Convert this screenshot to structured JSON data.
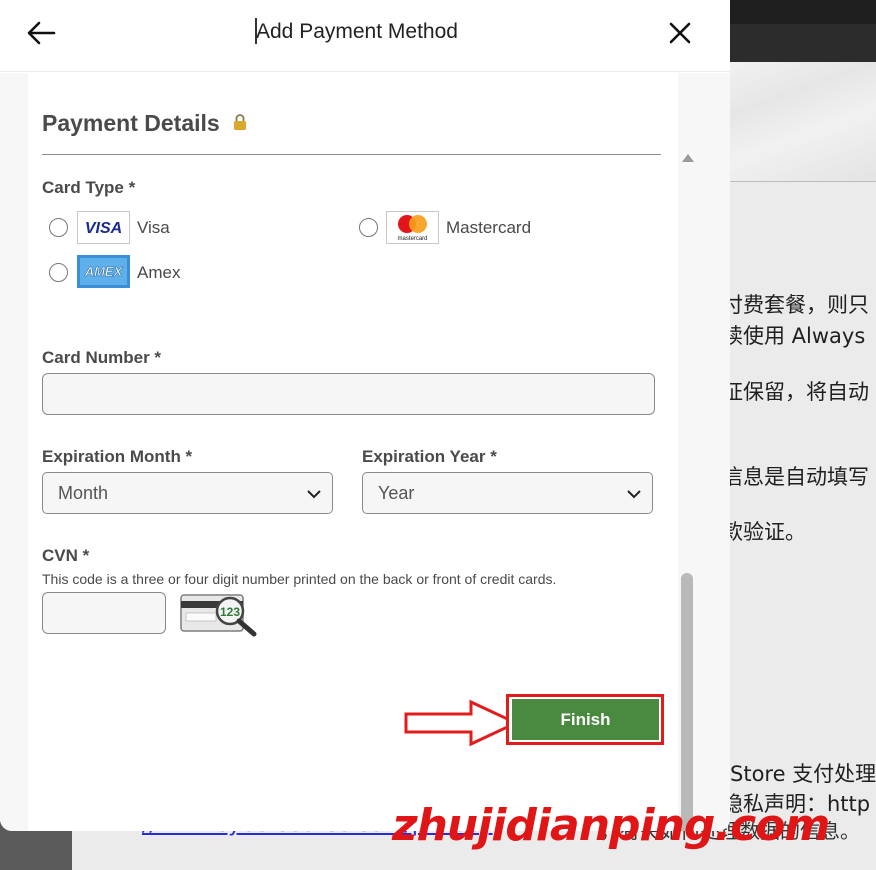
{
  "modal": {
    "title": "Add Payment Method"
  },
  "payment": {
    "section_title": "Payment Details",
    "card_type_label": "Card Type *",
    "card_types": [
      {
        "name": "Visa",
        "logo_text": "VISA"
      },
      {
        "name": "Mastercard",
        "logo_text": "mastercard"
      },
      {
        "name": "Amex",
        "logo_text": "AMEX"
      }
    ],
    "card_number_label": "Card Number *",
    "card_number_value": "",
    "expiration_month_label": "Expiration Month *",
    "expiration_month_value": "Month",
    "expiration_year_label": "Expiration Year *",
    "expiration_year_value": "Year",
    "cvn_label": "CVN *",
    "cvn_help": "This code is a three or four digit number printed on the back or front of credit cards.",
    "cvn_value": "",
    "cvn_image_text": "123",
    "finish_label": "Finish"
  },
  "background": {
    "text_lines": [
      "付费套餐，则只",
      "续使用 Always",
      "证保留，将自动",
      "信息是自动填写",
      "款验证。",
      " Store 支付处理",
      "隐私声明：http"
    ],
    "link_text": "//www.cybersource.com/privacy",
    "link_tail": "，有关如何处理数据的信息。",
    "watermark": "zhujidianping.com"
  },
  "colors": {
    "finish_button": "#4a8a40",
    "annotation_red": "#e21b1b",
    "watermark_red": "#e01616"
  }
}
